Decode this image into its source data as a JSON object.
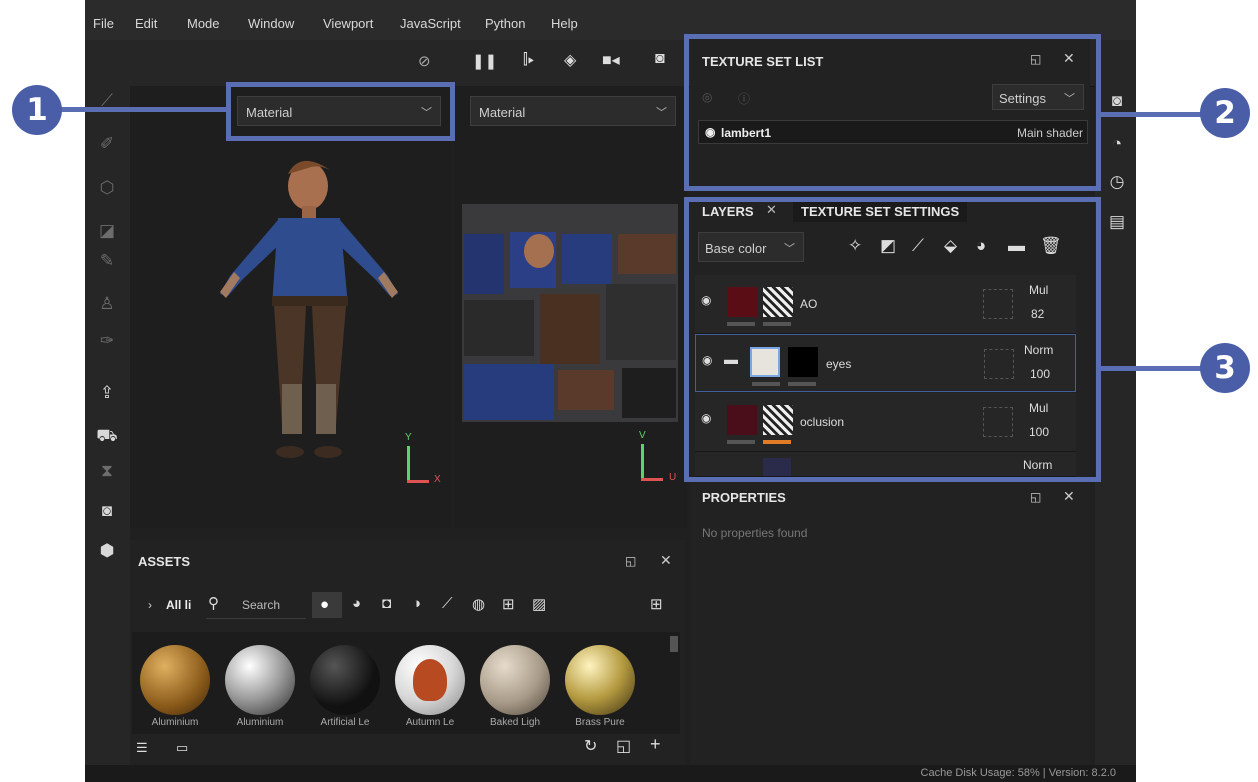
{
  "menu": [
    "File",
    "Edit",
    "Mode",
    "Window",
    "Viewport",
    "JavaScript",
    "Python",
    "Help"
  ],
  "viewport3d": {
    "dropdown": "Material",
    "axis_y": "Y",
    "axis_x": "X"
  },
  "viewport2d": {
    "dropdown": "Material",
    "axis_v": "V",
    "axis_u": "U"
  },
  "texture_set_list": {
    "title": "TEXTURE SET LIST",
    "settings": "Settings",
    "item_name": "lambert1",
    "item_shader": "Main shader"
  },
  "layers": {
    "tab_layers": "LAYERS",
    "tab_settings": "TEXTURE SET SETTINGS",
    "channel": "Base color",
    "rows": [
      {
        "name": "AO",
        "blend": "Mul",
        "opacity": "82"
      },
      {
        "name": "eyes",
        "blend": "Norm",
        "opacity": "100"
      },
      {
        "name": "oclusion",
        "blend": "Mul",
        "opacity": "100"
      },
      {
        "name": "",
        "blend": "Norm",
        "opacity": ""
      }
    ]
  },
  "properties": {
    "title": "PROPERTIES",
    "empty": "No properties found"
  },
  "assets": {
    "title": "ASSETS",
    "breadcrumb": "All li",
    "search": "Search",
    "items": [
      "Aluminium",
      "Aluminium",
      "Artificial Le",
      "Autumn Le",
      "Baked Ligh",
      "Brass Pure"
    ]
  },
  "status": {
    "text": "Cache Disk Usage:    58% | Version: 8.2.0"
  },
  "callouts": [
    "1",
    "2",
    "3"
  ],
  "colors": {
    "accent": "#5a6fb3",
    "badge": "#4a5ea8"
  }
}
